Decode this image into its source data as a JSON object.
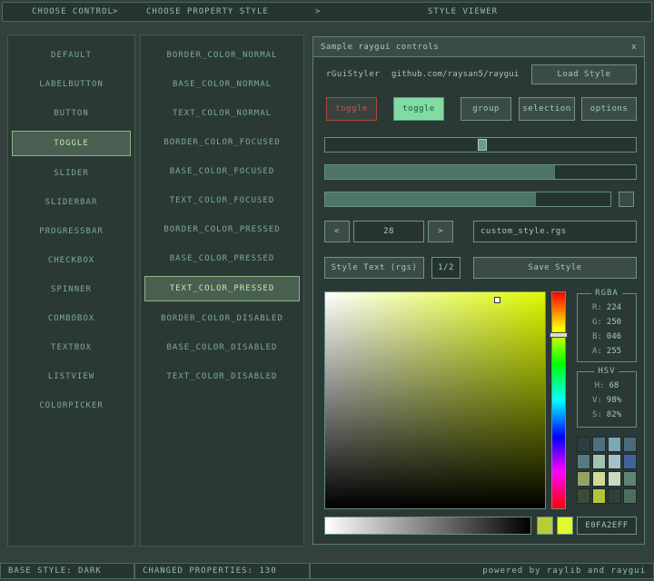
{
  "topbar": {
    "items": [
      "CHOOSE CONTROL",
      "CHOOSE PROPERTY STYLE",
      "STYLE VIEWER"
    ],
    "sep": ">"
  },
  "controls": {
    "items": [
      "DEFAULT",
      "LABELBUTTON",
      "BUTTON",
      "TOGGLE",
      "SLIDER",
      "SLIDERBAR",
      "PROGRESSBAR",
      "CHECKBOX",
      "SPINNER",
      "COMBOBOX",
      "TEXTBOX",
      "LISTVIEW",
      "COLORPICKER"
    ],
    "selected": "TOGGLE"
  },
  "properties": {
    "items": [
      "BORDER_COLOR_NORMAL",
      "BASE_COLOR_NORMAL",
      "TEXT_COLOR_NORMAL",
      "BORDER_COLOR_FOCUSED",
      "BASE_COLOR_FOCUSED",
      "TEXT_COLOR_FOCUSED",
      "BORDER_COLOR_PRESSED",
      "BASE_COLOR_PRESSED",
      "TEXT_COLOR_PRESSED",
      "BORDER_COLOR_DISABLED",
      "BASE_COLOR_DISABLED",
      "TEXT_COLOR_DISABLED"
    ],
    "selected": "TEXT_COLOR_PRESSED"
  },
  "viewer": {
    "title": "Sample raygui controls",
    "close": "x",
    "app_name": "rGuiStyler",
    "repo_url": "github.com/raysan5/raygui",
    "load_style": "Load Style",
    "toggle_standalone": "toggle",
    "toggle_active": "toggle",
    "toggle_group": [
      "group",
      "selection",
      "options"
    ],
    "slider_percent": 49,
    "progress_percent": 74,
    "sliderbar_percent": 74,
    "spinner": {
      "dec": "<",
      "value": "28",
      "inc": ">"
    },
    "filename": "custom_style.rgs",
    "style_text_btn": "Style Text (rgs)",
    "page_indicator": "1/2",
    "save_style": "Save Style",
    "picker": {
      "selected_color": "#e0fa2e",
      "previous_color": "#b9cc39",
      "hue": 68
    },
    "rgba": {
      "title": "RGBA",
      "rows": [
        {
          "label": "R:",
          "value": "224"
        },
        {
          "label": "G:",
          "value": "250"
        },
        {
          "label": "B:",
          "value": "046"
        },
        {
          "label": "A:",
          "value": "255"
        }
      ]
    },
    "hsv": {
      "title": "HSV",
      "rows": [
        {
          "label": "H:",
          "value": "68"
        },
        {
          "label": "V:",
          "value": "98%"
        },
        {
          "label": "S:",
          "value": "82%"
        }
      ]
    },
    "hex_value": "E0FA2EFF",
    "palette": [
      "#2e3d44",
      "#4e707e",
      "#7fa7b4",
      "#496b79",
      "#567a80",
      "#a2c2b2",
      "#a5c2cc",
      "#43629b",
      "#93a364",
      "#d0dc94",
      "#c9dabf",
      "#5d8474",
      "#3c4b33",
      "#b3c43b",
      "#303f38",
      "#4e6e5e"
    ]
  },
  "statusbar": {
    "base_style": "BASE STYLE: DARK",
    "changed_properties": "CHANGED PROPERTIES: 130",
    "credit": "powered by raylib and raygui"
  },
  "colors": {
    "accent": "#e0fa2e",
    "panel_bg": "#2b3936",
    "border": "#688e7e",
    "text": "#8fc0a8"
  }
}
